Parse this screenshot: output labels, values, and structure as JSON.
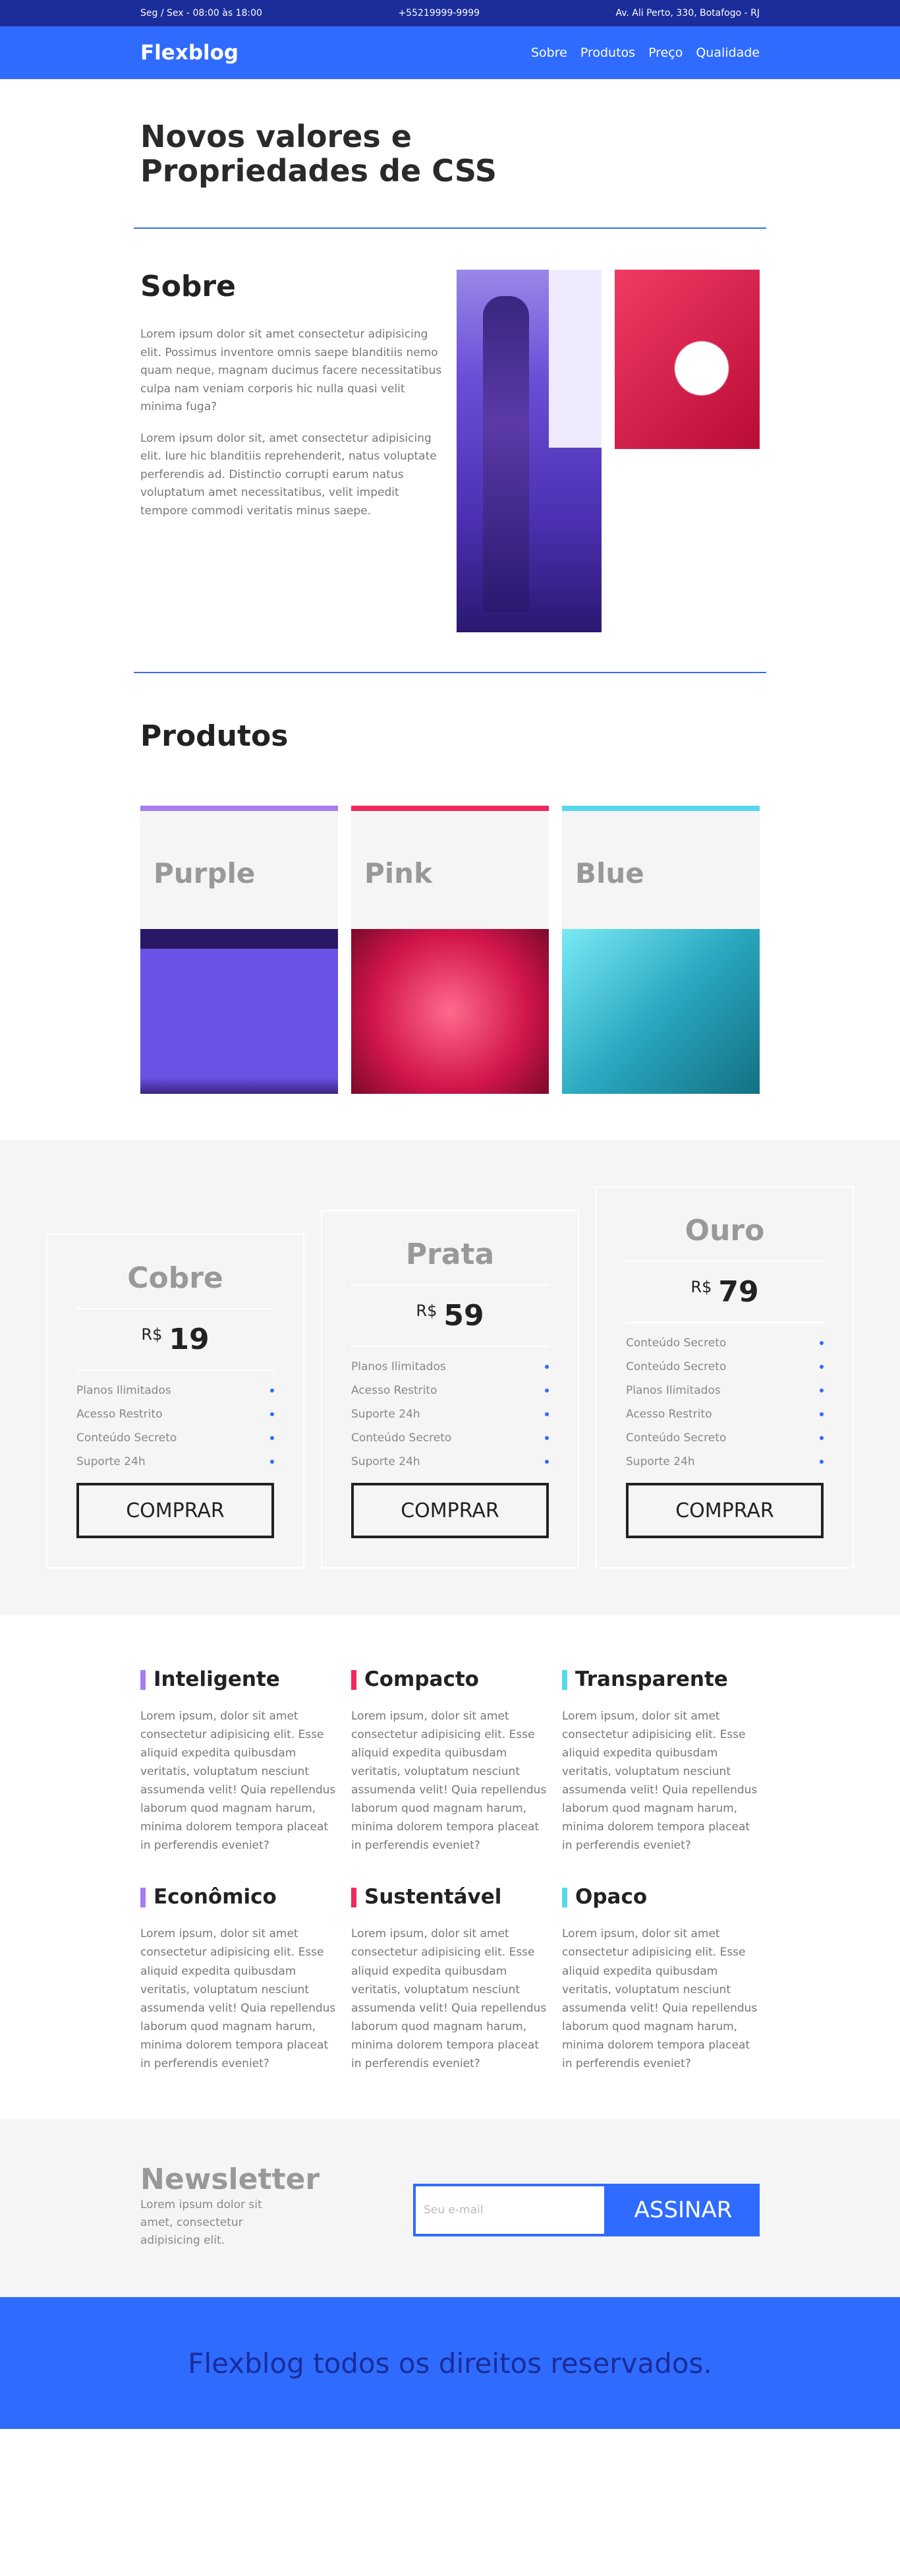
{
  "topbar": {
    "hours": "Seg / Sex - 08:00 às 18:00",
    "phone": "+55219999-9999",
    "address": "Av. Ali Perto, 330, Botafogo - RJ"
  },
  "header": {
    "logo": "Flexblog",
    "nav": [
      "Sobre",
      "Produtos",
      "Preço",
      "Qualidade"
    ]
  },
  "hero": {
    "title_line1": "Novos valores e",
    "title_line2": "Propriedades de CSS"
  },
  "sobre": {
    "title": "Sobre",
    "p1": "Lorem ipsum dolor sit amet consectetur adipisicing elit. Possimus inventore omnis saepe blanditiis nemo quam neque, magnam ducimus facere necessitatibus culpa nam veniam corporis hic nulla quasi velit minima fuga?",
    "p2": "Lorem ipsum dolor sit, amet consectetur adipisicing elit. Iure hic blanditiis reprehenderit, natus voluptate perferendis ad. Distinctio corrupti earum natus voluptatum amet necessitatibus, velit impedit tempore commodi veritatis minus saepe."
  },
  "produtos": {
    "title": "Produtos",
    "items": [
      "Purple",
      "Pink",
      "Blue"
    ]
  },
  "precos": {
    "plans": [
      {
        "name": "Cobre",
        "currency": "R$",
        "price": "19",
        "features": [
          "Planos Ilimitados",
          "Acesso Restrito",
          "Conteúdo Secreto",
          "Suporte 24h"
        ],
        "button": "COMPRAR"
      },
      {
        "name": "Prata",
        "currency": "R$",
        "price": "59",
        "features": [
          "Planos Ilimitados",
          "Acesso Restrito",
          "Suporte 24h",
          "Conteúdo Secreto",
          "Suporte 24h"
        ],
        "button": "COMPRAR"
      },
      {
        "name": "Ouro",
        "currency": "R$",
        "price": "79",
        "features": [
          "Conteúdo Secreto",
          "Conteúdo Secreto",
          "Planos Ilimitados",
          "Acesso Restrito",
          "Conteúdo Secreto",
          "Suporte 24h"
        ],
        "button": "COMPRAR"
      }
    ]
  },
  "features": {
    "text": "Lorem ipsum, dolor sit amet consectetur adipisicing elit. Esse aliquid expedita quibusdam veritatis, voluptatum nesciunt assumenda velit! Quia repellendus laborum quod magnam harum, minima dolorem tempora placeat in perferendis eveniet?",
    "items": [
      "Inteligente",
      "Compacto",
      "Transparente",
      "Econômico",
      "Sustentável",
      "Opaco"
    ]
  },
  "newsletter": {
    "title": "Newsletter",
    "desc": "Lorem ipsum dolor sit amet, consectetur adipisicing elit.",
    "placeholder": "Seu e-mail",
    "button": "ASSINAR"
  },
  "footer": {
    "text": "Flexblog todos os direitos reservados."
  }
}
